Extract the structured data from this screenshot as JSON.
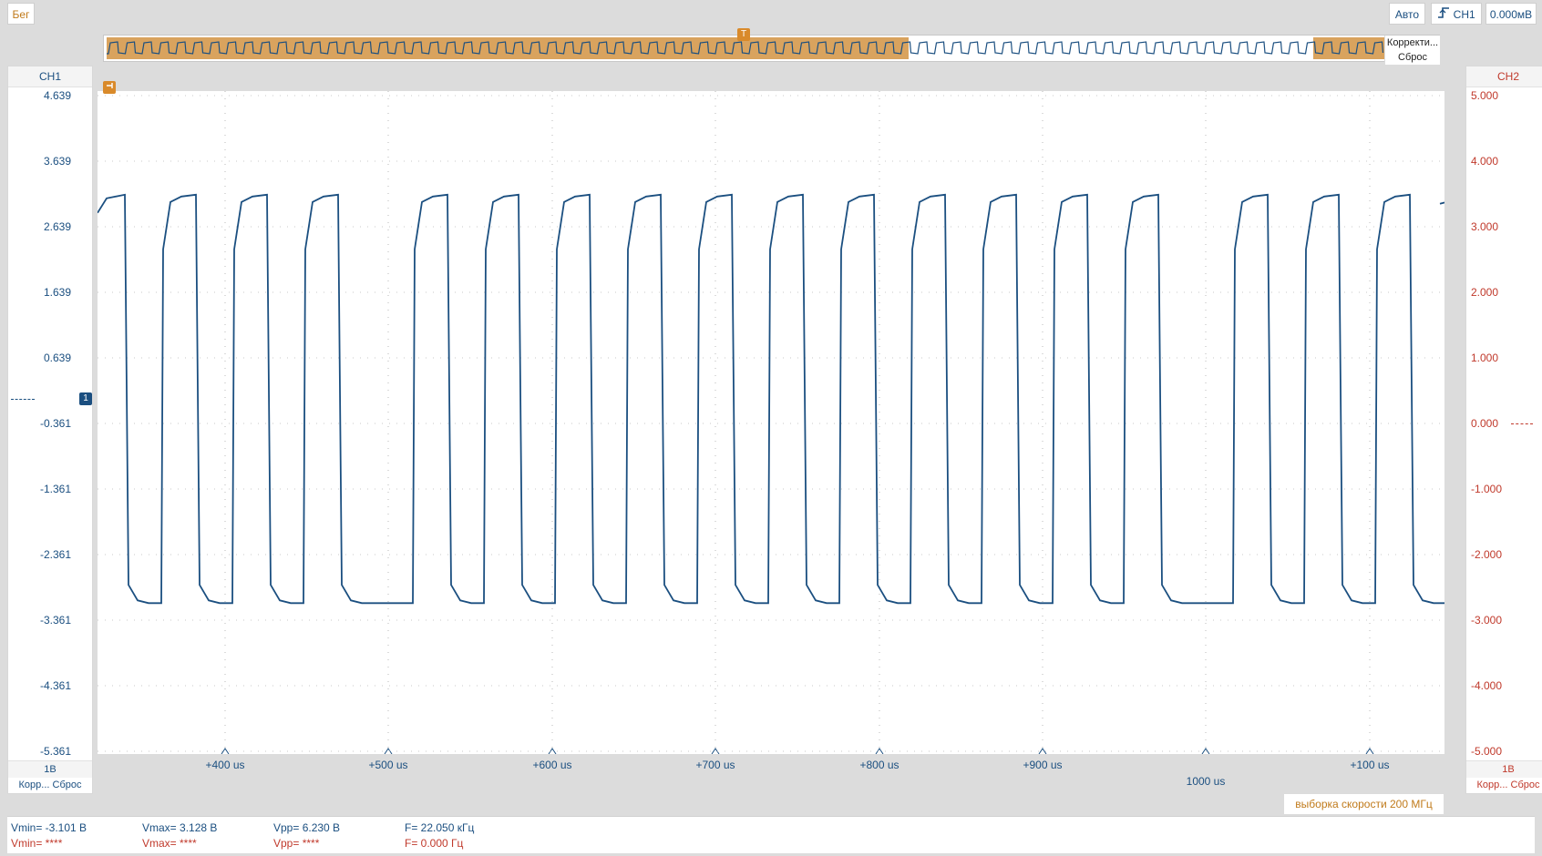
{
  "toolbar": {
    "run_label": "Бег",
    "mode_label": "Авто",
    "trigger_channel_label": "CH1",
    "trigger_level_label": "0.000мВ"
  },
  "overview": {
    "correction_label": "Корректи...",
    "reset_label": "Сброс",
    "trigger_marker": "T"
  },
  "ch1_panel": {
    "title": "CH1",
    "scale": "1В",
    "correction_label": "Корр...",
    "reset_label": "Сброс",
    "color": "#1b4f80",
    "y_labels": [
      "4.639",
      "3.639",
      "2.639",
      "1.639",
      "0.639",
      "-0.361",
      "-1.361",
      "-2.361",
      "-3.361",
      "-4.361",
      "-5.361"
    ],
    "ground_marker": "1"
  },
  "ch2_panel": {
    "title": "CH2",
    "scale": "1В",
    "correction_label": "Корр...",
    "reset_label": "Сброс",
    "color": "#c0392b",
    "y_labels": [
      "5.000",
      "4.000",
      "3.000",
      "2.000",
      "1.000",
      "0.000",
      "-1.000",
      "-2.000",
      "-3.000",
      "-4.000",
      "-5.000"
    ]
  },
  "x_axis": {
    "labels": [
      "+400 us",
      "+500 us",
      "+600 us",
      "+700 us",
      "+800 us",
      "+900 us",
      "+100 us"
    ],
    "center_label": "1000 us"
  },
  "sample_rate_label": "выборка скорости 200 МГц",
  "measurements": {
    "ch1": {
      "vmin": "Vmin= -3.101 В",
      "vmax": "Vmax= 3.128 В",
      "vpp": "Vpp= 6.230 В",
      "freq": "F= 22.050 кГц"
    },
    "ch2": {
      "vmin": "Vmin= ****",
      "vmax": "Vmax= ****",
      "vpp": "Vpp= ****",
      "freq": "F= 0.000 Гц"
    }
  },
  "chart_data": {
    "type": "line",
    "title": "",
    "xlabel": "",
    "ylabel": "",
    "series": [
      {
        "channel": "CH1",
        "shape": "square-wave",
        "high": 3.128,
        "low": -3.101,
        "frequency_khz": 22.05
      }
    ],
    "y_range_ch1": [
      -5.361,
      4.639
    ],
    "y_range_ch2": [
      -5.0,
      5.0
    ],
    "grid": true,
    "accent_color": "#d9a35e"
  }
}
